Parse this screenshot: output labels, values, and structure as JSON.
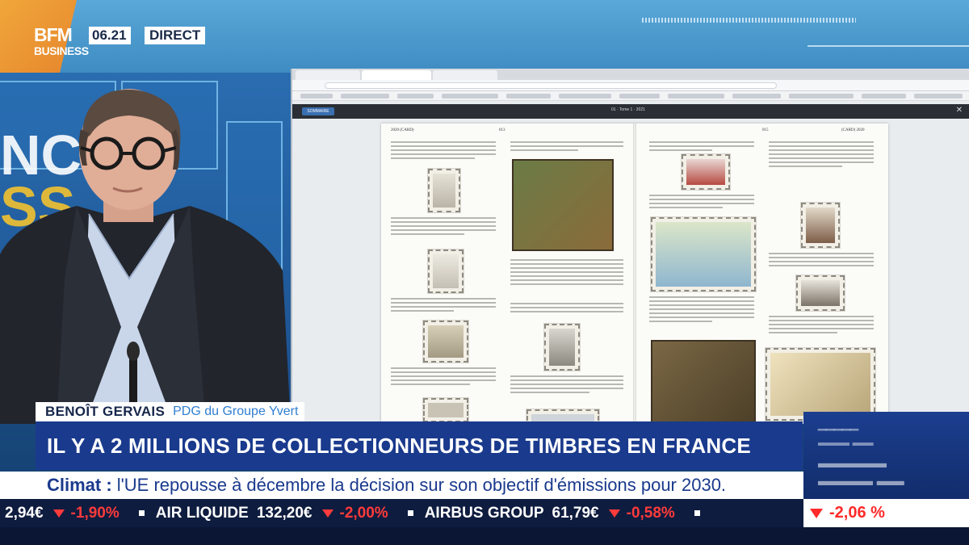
{
  "channel": {
    "logo_line1": "BFM",
    "logo_line2": "BUSINESS",
    "time": "06.21",
    "live_label": "DIRECT"
  },
  "lower_third": {
    "name": "BENOÎT GERVAIS",
    "role": "PDG du Groupe Yvert",
    "headline": "IL Y A 2 MILLIONS DE COLLECTIONNEURS DE TIMBRES EN FRANCE"
  },
  "news_strip": {
    "label": "Climat :",
    "text": "l'UE repousse à décembre la décision sur son objectif d'émissions pour 2030."
  },
  "ticker": {
    "items": [
      {
        "name": "",
        "price": "2,94€",
        "change": "-1,90%"
      },
      {
        "name": "AIR LIQUIDE",
        "price": "132,20€",
        "change": "-2,00%"
      },
      {
        "name": "AIRBUS GROUP",
        "price": "61,79€",
        "change": "-0,58%"
      }
    ]
  },
  "market_panel": {
    "change": "-2,06 %"
  },
  "monitor": {
    "viewer_button": "SOMMAIRE",
    "viewer_title": "01 · Tome 1 · 2021",
    "left_page_header": "2020 (CARD)",
    "left_page_number": "013",
    "right_page_header": "(CARD) 2020",
    "right_page_number": "015"
  },
  "colors": {
    "accent_orange": "#f0a73a",
    "headline_blue": "#1a3a8d",
    "ticker_negative": "#ff3b3b"
  }
}
